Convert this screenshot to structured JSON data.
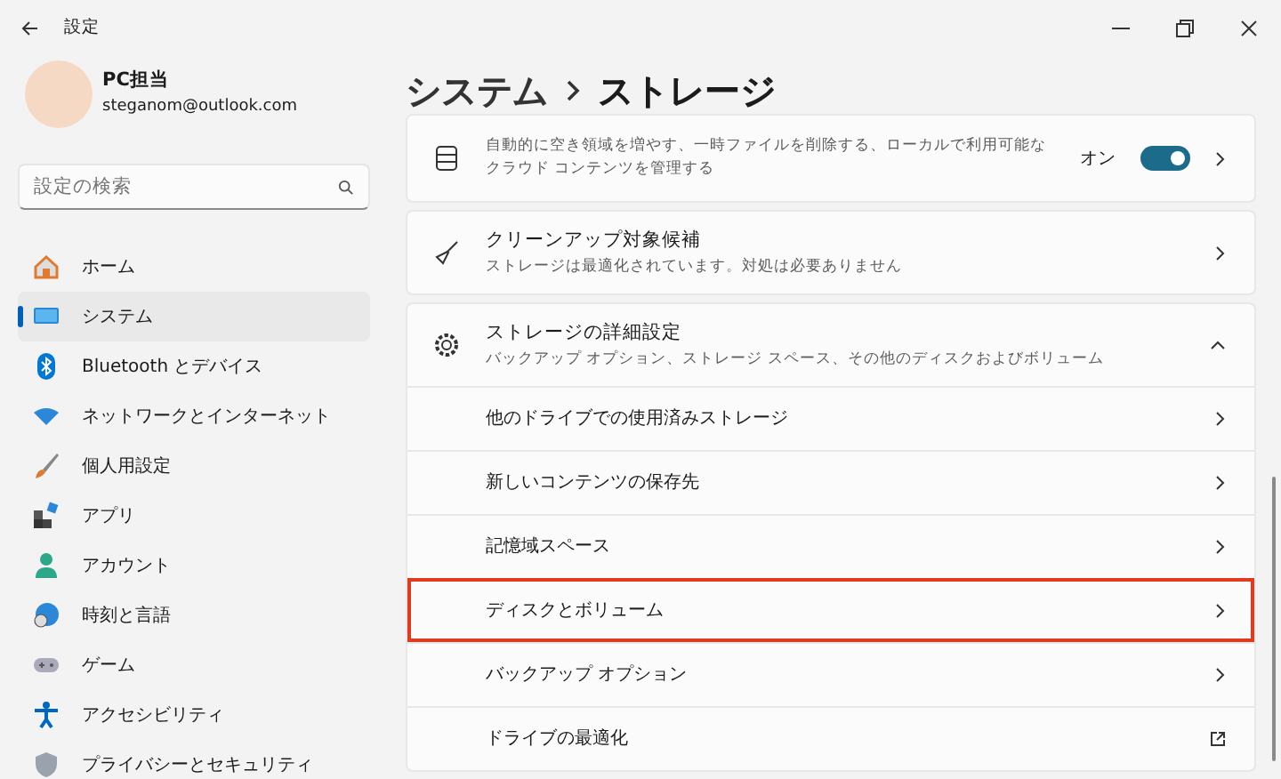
{
  "window": {
    "title": "設定"
  },
  "user": {
    "name": "PC担当",
    "email": "steganom@outlook.com"
  },
  "search": {
    "placeholder": "設定の検索"
  },
  "sidebar": {
    "items": [
      {
        "label": "ホーム",
        "selected": false
      },
      {
        "label": "システム",
        "selected": true
      },
      {
        "label": "Bluetooth とデバイス",
        "selected": false
      },
      {
        "label": "ネットワークとインターネット",
        "selected": false
      },
      {
        "label": "個人用設定",
        "selected": false
      },
      {
        "label": "アプリ",
        "selected": false
      },
      {
        "label": "アカウント",
        "selected": false
      },
      {
        "label": "時刻と言語",
        "selected": false
      },
      {
        "label": "ゲーム",
        "selected": false
      },
      {
        "label": "アクセシビリティ",
        "selected": false
      },
      {
        "label": "プライバシーとセキュリティ",
        "selected": false
      }
    ]
  },
  "breadcrumb": [
    "システム",
    "ストレージ"
  ],
  "cards": [
    {
      "kind": "toggle",
      "description": "自動的に空き領域を増やす、一時ファイルを削除する、ローカルで利用可能なクラウド コンテンツを管理する",
      "toggle_label": "オン",
      "on": true
    },
    {
      "kind": "link",
      "title": "クリーンアップ対象候補",
      "description": "ストレージは最適化されています。対処は必要ありません"
    },
    {
      "kind": "expander",
      "title": "ストレージの詳細設定",
      "description": "バックアップ オプション、ストレージ スペース、その他のディスクおよびボリューム",
      "expanded": true,
      "children": [
        {
          "label": "他のドライブでの使用済みストレージ",
          "kind": "link",
          "highlighted": false
        },
        {
          "label": "新しいコンテンツの保存先",
          "kind": "link",
          "highlighted": false
        },
        {
          "label": "記憶域スペース",
          "kind": "link",
          "highlighted": false
        },
        {
          "label": "ディスクとボリューム",
          "kind": "link",
          "highlighted": true
        },
        {
          "label": "バックアップ オプション",
          "kind": "link",
          "highlighted": false
        },
        {
          "label": "ドライブの最適化",
          "kind": "external",
          "highlighted": false
        }
      ]
    }
  ]
}
